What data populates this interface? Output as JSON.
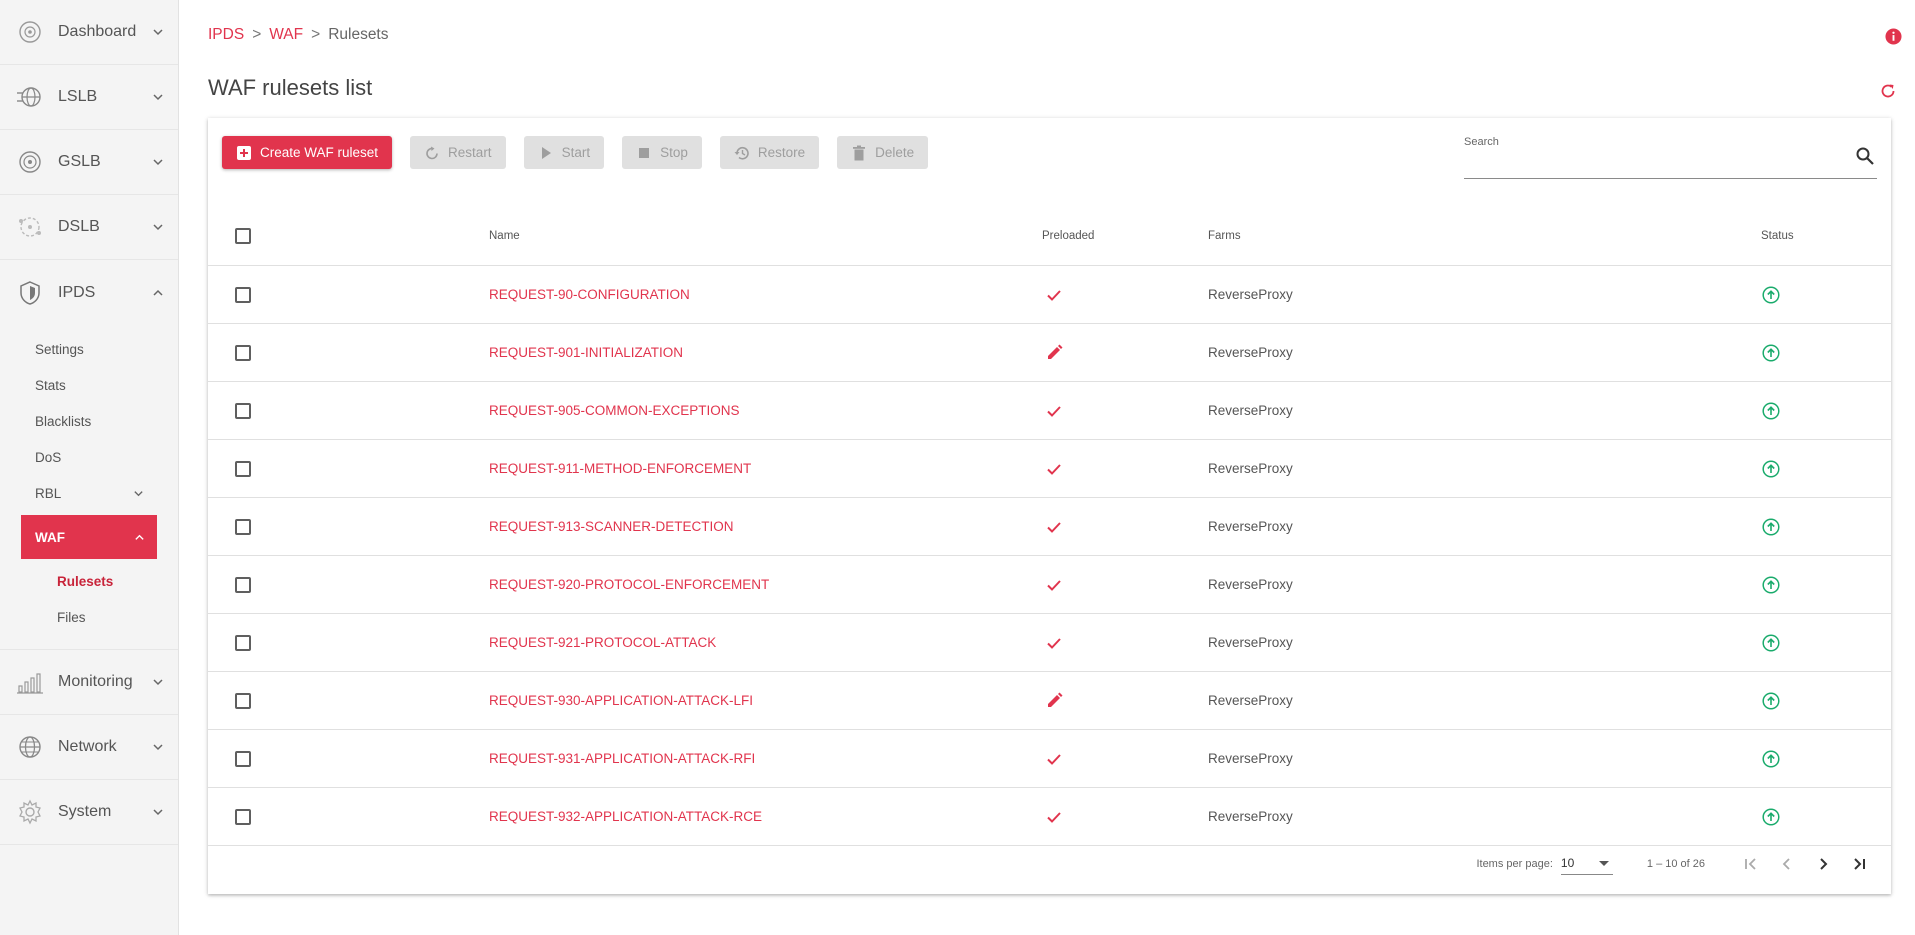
{
  "sidebar": {
    "items": [
      {
        "label": "Dashboard",
        "icon": "dashboard-icon"
      },
      {
        "label": "LSLB",
        "icon": "lslb-icon"
      },
      {
        "label": "GSLB",
        "icon": "gslb-icon"
      },
      {
        "label": "DSLB",
        "icon": "dslb-icon"
      },
      {
        "label": "IPDS",
        "icon": "ipds-shield-icon"
      }
    ],
    "ipds_sub": {
      "settings": "Settings",
      "stats": "Stats",
      "blacklists": "Blacklists",
      "dos": "DoS",
      "rbl": "RBL",
      "waf": "WAF",
      "rulesets": "Rulesets",
      "files": "Files"
    },
    "bottom_items": [
      {
        "label": "Monitoring",
        "icon": "monitoring-icon"
      },
      {
        "label": "Network",
        "icon": "network-icon"
      },
      {
        "label": "System",
        "icon": "system-gear-icon"
      }
    ]
  },
  "breadcrumb": {
    "ipds": "IPDS",
    "waf": "WAF",
    "current": "Rulesets",
    "sep": ">"
  },
  "page": {
    "title": "WAF rulesets list"
  },
  "toolbar": {
    "create": "Create WAF ruleset",
    "restart": "Restart",
    "start": "Start",
    "stop": "Stop",
    "restore": "Restore",
    "delete": "Delete"
  },
  "search": {
    "label": "Search",
    "placeholder": ""
  },
  "table": {
    "headers": {
      "name": "Name",
      "preloaded": "Preloaded",
      "farms": "Farms",
      "status": "Status"
    },
    "rows": [
      {
        "name": "REQUEST-90-CONFIGURATION",
        "preloaded": "check",
        "farms": "ReverseProxy",
        "status": "up"
      },
      {
        "name": "REQUEST-901-INITIALIZATION",
        "preloaded": "edit",
        "farms": "ReverseProxy",
        "status": "up"
      },
      {
        "name": "REQUEST-905-COMMON-EXCEPTIONS",
        "preloaded": "check",
        "farms": "ReverseProxy",
        "status": "up"
      },
      {
        "name": "REQUEST-911-METHOD-ENFORCEMENT",
        "preloaded": "check",
        "farms": "ReverseProxy",
        "status": "up"
      },
      {
        "name": "REQUEST-913-SCANNER-DETECTION",
        "preloaded": "check",
        "farms": "ReverseProxy",
        "status": "up"
      },
      {
        "name": "REQUEST-920-PROTOCOL-ENFORCEMENT",
        "preloaded": "check",
        "farms": "ReverseProxy",
        "status": "up"
      },
      {
        "name": "REQUEST-921-PROTOCOL-ATTACK",
        "preloaded": "check",
        "farms": "ReverseProxy",
        "status": "up"
      },
      {
        "name": "REQUEST-930-APPLICATION-ATTACK-LFI",
        "preloaded": "edit",
        "farms": "ReverseProxy",
        "status": "up"
      },
      {
        "name": "REQUEST-931-APPLICATION-ATTACK-RFI",
        "preloaded": "check",
        "farms": "ReverseProxy",
        "status": "up"
      },
      {
        "name": "REQUEST-932-APPLICATION-ATTACK-RCE",
        "preloaded": "check",
        "farms": "ReverseProxy",
        "status": "up"
      }
    ]
  },
  "paginator": {
    "items_per_page_label": "Items per page:",
    "items_per_page": "10",
    "range": "1 – 10 of 26"
  },
  "colors": {
    "accent": "#e1344d",
    "status_up": "#1aab6c",
    "disabled_bg": "#e0e0e0"
  }
}
